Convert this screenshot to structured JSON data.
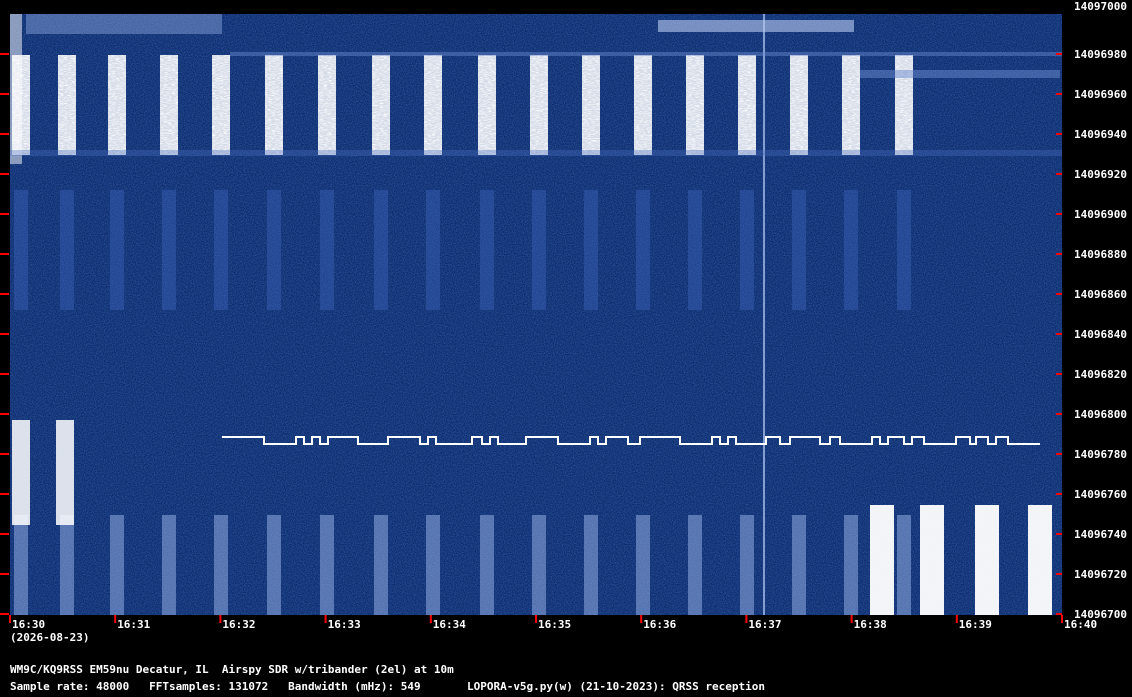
{
  "header_freq": "14097000",
  "date": "(2026-08-23)",
  "y_ticks": [
    "14096980",
    "14096960",
    "14096940",
    "14096920",
    "14096900",
    "14096880",
    "14096860",
    "14096840",
    "14096820",
    "14096800",
    "14096780",
    "14096760",
    "14096740",
    "14096720",
    "14096700"
  ],
  "x_ticks": [
    "16:30",
    "16:31",
    "16:32",
    "16:33",
    "16:34",
    "16:35",
    "16:36",
    "16:37",
    "16:38",
    "16:39",
    "16:40"
  ],
  "info_line1": "WM9C/KQ9RSS EM59nu Decatur, IL  Airspy SDR w/tribander (2el) at 10m",
  "info_line2": "Sample rate: 48000   FFTsamples: 131072   Bandwidth (mHz): 549       LOPORA-v5g.py(w) (21-10-2023): QRSS reception",
  "colors": {
    "background": "#0d2a6e",
    "tick": "#ff0000",
    "signal": "#ffffff"
  }
}
